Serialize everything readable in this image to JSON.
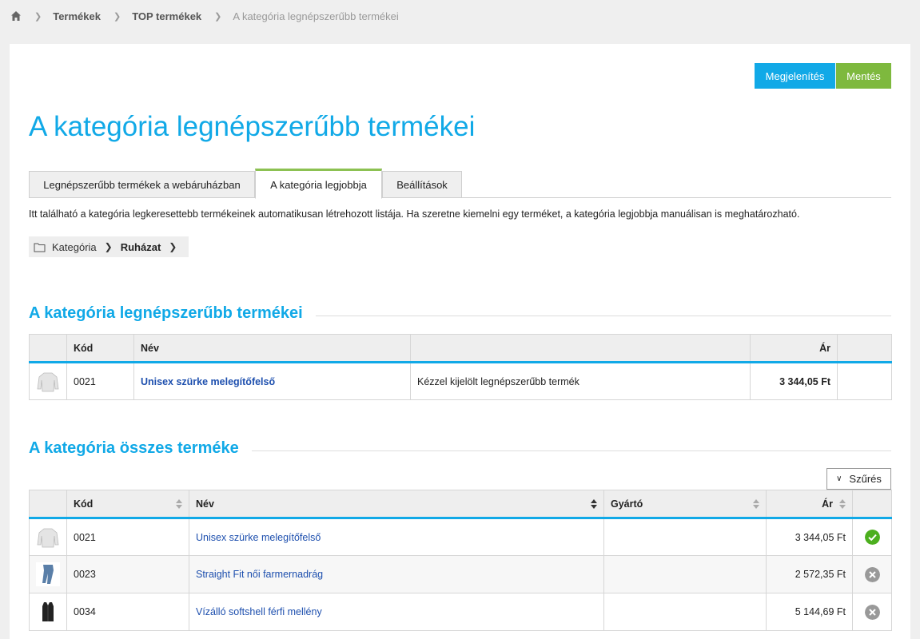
{
  "breadcrumb": {
    "items": [
      "Termékek",
      "TOP termékek"
    ],
    "current": "A kategória legnépszerűbb termékei"
  },
  "actions": {
    "view_label": "Megjelenítés",
    "save_label": "Mentés"
  },
  "page_title": "A kategória legnépszerűbb termékei",
  "tabs": [
    {
      "label": "Legnépszerűbb termékek a webáruházban",
      "active": false
    },
    {
      "label": "A kategória legjobbja",
      "active": true
    },
    {
      "label": "Beállítások",
      "active": false
    }
  ],
  "intro": "Itt található a kategória legkeresettebb termékeinek automatikusan létrehozott listája. Ha szeretne kiemelni egy terméket, a kategória legjobbja manuálisan is meghatározható.",
  "category_path": {
    "label": "Kategória",
    "current": "Ruházat"
  },
  "top_section": {
    "title": "A kategória legnépszerűbb termékei",
    "columns": {
      "code": "Kód",
      "name": "Név",
      "note": "",
      "price": "Ár"
    },
    "rows": [
      {
        "code": "0021",
        "name": "Unisex szürke melegítőfelső",
        "note": "Kézzel kijelölt legnépszerűbb termék",
        "price": "3 344,05 Ft",
        "thumb": "sweater"
      }
    ]
  },
  "all_section": {
    "title": "A kategória összes terméke",
    "filter_label": "Szűrés",
    "columns": {
      "code": "Kód",
      "name": "Név",
      "maker": "Gyártó",
      "price": "Ár"
    },
    "rows": [
      {
        "code": "0021",
        "name": "Unisex szürke melegítőfelső",
        "maker": "",
        "price": "3 344,05 Ft",
        "thumb": "sweater",
        "status": "selected"
      },
      {
        "code": "0023",
        "name": "Straight Fit női farmernadrág",
        "maker": "",
        "price": "2 572,35 Ft",
        "thumb": "jeans",
        "status": "not-selected"
      },
      {
        "code": "0034",
        "name": "Vízálló softshell férfi mellény",
        "maker": "",
        "price": "5 144,69 Ft",
        "thumb": "vest",
        "status": "not-selected"
      }
    ]
  },
  "colors": {
    "accent": "#11a9e7",
    "save": "#7eb93e",
    "active_tab": "#8cc152",
    "link": "#1d4fae",
    "ok": "#4caf1e",
    "off": "#999999"
  }
}
